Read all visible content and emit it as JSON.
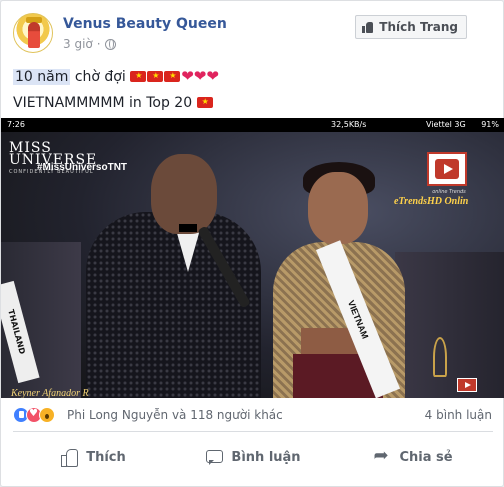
{
  "post": {
    "page_name": "Venus Beauty Queen",
    "time": "3 giờ",
    "privacy_icon": "globe-icon",
    "like_page_label": "Thích Trang",
    "text_line1_highlight": "10 năm",
    "text_line1_rest": "chờ đợi",
    "text_line2": "VIETNAMMMMM in Top 20"
  },
  "video": {
    "status_time": "7:26",
    "status_network": "32,5KB/s",
    "status_carrier": "Viettel 3G",
    "status_battery": "91%",
    "logo_line1": "MISS",
    "logo_line2": "UNIVERSE",
    "logo_tagline": "CONFIDENTLY BEAUTIFUL",
    "hashtag": "#MissUniversoTNT",
    "watermark_small": "online Trends",
    "watermark": "eTrendsHD Onlin",
    "credit": "Keyner Afanador R",
    "sash_main": "VIETNAM",
    "sash_left": "THAILAND"
  },
  "reactions": {
    "icons": [
      "like-icon",
      "love-icon",
      "wow-icon"
    ],
    "names": "Phi Long Nguyễn và 118 người khác",
    "comments": "4 bình luận"
  },
  "actions": {
    "like": "Thích",
    "comment": "Bình luận",
    "share": "Chia sẻ"
  },
  "colors": {
    "link": "#365899",
    "muted": "#90949c",
    "like_blue": "#4080ff",
    "love_red": "#f25268",
    "flag_red": "#da251d"
  }
}
